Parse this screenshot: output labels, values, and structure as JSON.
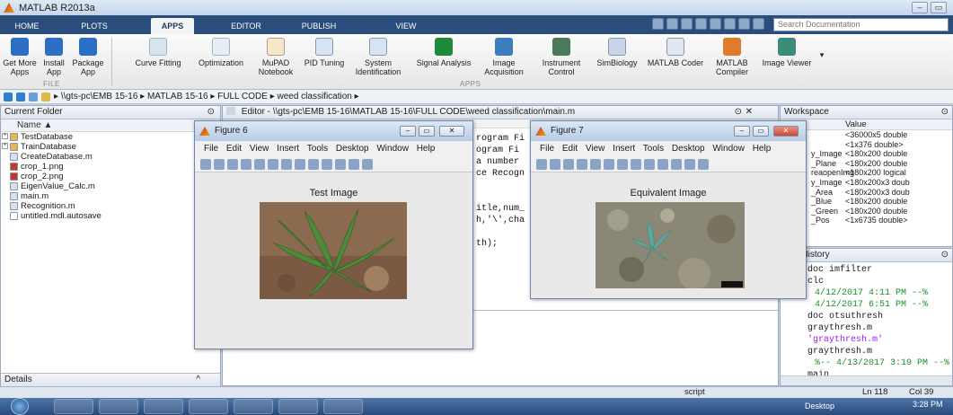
{
  "window": {
    "title": "MATLAB R2013a"
  },
  "tabs": [
    {
      "label": "HOME"
    },
    {
      "label": "PLOTS"
    },
    {
      "label": "APPS"
    },
    {
      "label": "EDITOR"
    },
    {
      "label": "PUBLISH"
    },
    {
      "label": "VIEW"
    }
  ],
  "search": {
    "placeholder": "Search Documentation"
  },
  "ribbon": {
    "file_buttons": [
      {
        "label": "Get More Apps",
        "icon": "download-icon"
      },
      {
        "label": "Install App",
        "icon": "install-icon"
      },
      {
        "label": "Package App",
        "icon": "package-icon"
      }
    ],
    "file_group": "FILE",
    "apps": [
      {
        "label": "Curve Fitting",
        "icon": "curve-fitting-icon"
      },
      {
        "label": "Optimization",
        "icon": "optimization-icon"
      },
      {
        "label": "MuPAD Notebook",
        "icon": "mupad-icon"
      },
      {
        "label": "PID Tuning",
        "icon": "pid-icon"
      },
      {
        "label": "System Identification",
        "icon": "system-id-icon"
      },
      {
        "label": "Signal Analysis",
        "icon": "signal-icon"
      },
      {
        "label": "Image Acquisition",
        "icon": "image-acq-icon"
      },
      {
        "label": "Instrument Control",
        "icon": "instrument-icon"
      },
      {
        "label": "SimBiology",
        "icon": "simbiology-icon"
      },
      {
        "label": "MATLAB Coder",
        "icon": "coder-icon"
      },
      {
        "label": "MATLAB Compiler",
        "icon": "compiler-icon"
      },
      {
        "label": "Image Viewer",
        "icon": "image-viewer-icon"
      }
    ],
    "apps_group": "APPS"
  },
  "address": {
    "path": "▸ \\\\gts-pc\\EMB 15-16  ▸  MATLAB 15-16  ▸  FULL CODE  ▸  weed classification  ▸"
  },
  "current_folder": {
    "title": "Current Folder",
    "column": "Name ▲",
    "items": [
      {
        "name": "TestDatabase",
        "type": "folder"
      },
      {
        "name": "TrainDatabase",
        "type": "folder"
      },
      {
        "name": "CreateDatabase.m",
        "type": "m"
      },
      {
        "name": "crop_1.png",
        "type": "png"
      },
      {
        "name": "crop_2.png",
        "type": "png"
      },
      {
        "name": "EigenValue_Calc.m",
        "type": "m"
      },
      {
        "name": "main.m",
        "type": "m"
      },
      {
        "name": "Recognition.m",
        "type": "m"
      },
      {
        "name": "untitled.mdl.autosave",
        "type": "file"
      }
    ],
    "details": "Details"
  },
  "editor": {
    "title": "Editor - \\\\gts-pc\\EMB 15-16\\MATLAB 15-16\\FULL CODE\\weed classification\\main.m",
    "lines": [
      "rogram Fi",
      "ogram Fi",
      "a number",
      "ce Recogn",
      "",
      "",
      "itle,num_",
      "h,'\\',cha",
      "",
      "th);"
    ]
  },
  "workspace": {
    "title": "Workspace",
    "value_header": "Value",
    "rows": [
      {
        "name": "",
        "value": "<36000x5 double"
      },
      {
        "name": "",
        "value": "<1x376 double>"
      },
      {
        "name": "y_Image",
        "value": "<180x200 double"
      },
      {
        "name": "_Plane",
        "value": "<180x200 double"
      },
      {
        "name": "reaopenImg",
        "value": "<180x200 logical"
      },
      {
        "name": "y_Image",
        "value": "<180x200x3 doub"
      },
      {
        "name": "_Area",
        "value": "<180x200x3 doub"
      },
      {
        "name": "_Blue",
        "value": "<180x200 double"
      },
      {
        "name": "_Green",
        "value": "<180x200 double"
      },
      {
        "name": "_Pos",
        "value": "<1x6735 double>"
      }
    ]
  },
  "history": {
    "title": "and History",
    "lines": [
      {
        "text": "doc imfilter",
        "style": "cmd"
      },
      {
        "text": "clc",
        "style": "plain"
      },
      {
        "text": "4/12/2017 4:11 PM --%",
        "style": "date"
      },
      {
        "text": "4/12/2017 6:51 PM --%",
        "style": "date"
      },
      {
        "text": "doc otsuthresh",
        "style": "cmd"
      },
      {
        "text": "graythresh.m",
        "style": "plain"
      },
      {
        "text": "'graythresh.m'",
        "style": "string"
      },
      {
        "text": "graythresh.m",
        "style": "plain"
      },
      {
        "text": "%-- 4/13/2017 3:19 PM --%",
        "style": "date"
      },
      {
        "text": "main",
        "style": "plain"
      }
    ]
  },
  "figure6": {
    "title": "Figure 6",
    "menu": "File  Edit  View  Insert  Tools  Desktop  Window  Help",
    "caption": "Test Image"
  },
  "figure7": {
    "title": "Figure 7",
    "menu": "File  Edit  View  Insert  Tools  Desktop  Window  Help",
    "caption": "Equivalent Image"
  },
  "status": {
    "mode": "script",
    "ln": "Ln  118",
    "col": "Col  39"
  },
  "taskbar": {
    "desktop": "Desktop",
    "time": "3:28 PM"
  }
}
